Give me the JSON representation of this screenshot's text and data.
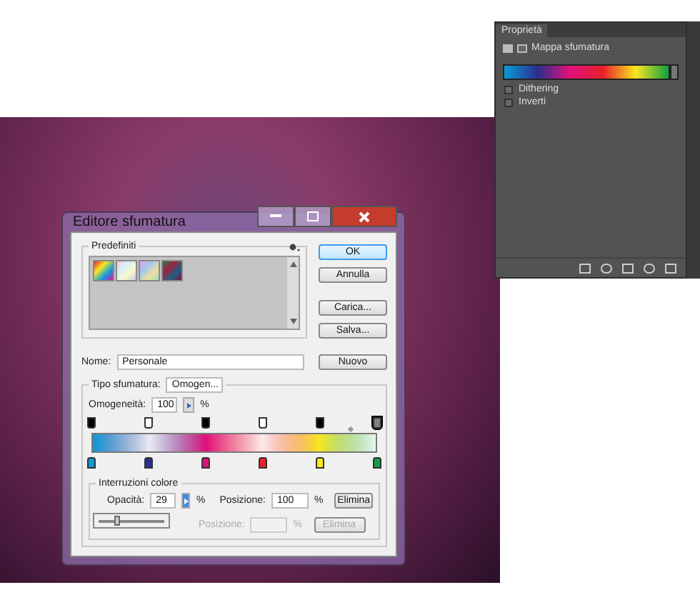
{
  "panel": {
    "title": "Proprietà",
    "header": "Mappa sfumatura",
    "options": [
      {
        "label": "Dithering",
        "checked": false
      },
      {
        "label": "Inverti",
        "checked": false
      }
    ]
  },
  "dialog": {
    "title": "Editore sfumatura",
    "presets": {
      "label": "Predefiniti",
      "swatches": [
        {
          "selected": false
        },
        {
          "selected": false
        },
        {
          "selected": false
        },
        {
          "selected": false
        }
      ]
    },
    "buttons": [
      "OK",
      "Annulla",
      "Carica...",
      "Salva..."
    ],
    "name": {
      "label": "Nome:",
      "value": "Personale",
      "button": "Nuovo"
    },
    "type": {
      "label": "Tipo sfumatura:",
      "value": "Omogen..."
    },
    "smoothness": {
      "label": "Omogeneità:",
      "value": "100",
      "unit": "%"
    },
    "opacity_stops": [
      {
        "level": 0,
        "color": "#000000",
        "selected": false
      },
      {
        "level": 0.2,
        "color": "#ffffff",
        "selected": false
      },
      {
        "level": 0.4,
        "color": "#000000",
        "selected": false
      },
      {
        "level": 0.6,
        "color": "#ffffff",
        "selected": false
      },
      {
        "level": 0.8,
        "color": "#000000",
        "selected": false
      },
      {
        "level": 1,
        "color": "#808080",
        "selected": true
      }
    ],
    "color_stops": [
      {
        "level": 0,
        "color": "#0a9ad8"
      },
      {
        "level": 0.2,
        "color": "#2a2f8e"
      },
      {
        "level": 0.4,
        "color": "#e0107a"
      },
      {
        "level": 0.6,
        "color": "#e8202a"
      },
      {
        "level": 0.8,
        "color": "#f8e820"
      },
      {
        "level": 1,
        "color": "#10a040"
      }
    ],
    "stops_group": {
      "label": "Interruzioni colore",
      "opacity": {
        "label": "Opacità:",
        "value": "29",
        "unit": "%",
        "level": 0.29
      },
      "position": {
        "label": "Posizione:",
        "value": "100",
        "unit": "%"
      },
      "delete": "Elimina",
      "position2": {
        "label": "Posizione:",
        "unit": "%"
      },
      "delete2": "Elimina"
    }
  }
}
